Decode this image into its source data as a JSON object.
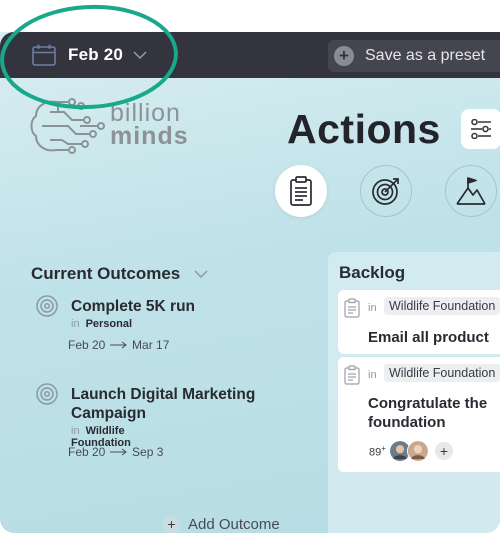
{
  "topbar": {
    "date": "Feb 20",
    "preset_label": "Save as a preset",
    "preset_icon": "+"
  },
  "logo": {
    "line1": "billion",
    "line2": "minds"
  },
  "page": {
    "title": "Actions"
  },
  "tabs": [
    {
      "icon": "clipboard-icon",
      "active": true
    },
    {
      "icon": "target-icon",
      "active": false
    },
    {
      "icon": "mountain-flag-icon",
      "active": false
    }
  ],
  "outcomes": {
    "header": "Current Outcomes",
    "items": [
      {
        "name": "Complete 5K run",
        "in_label": "in",
        "project": "Personal",
        "start": "Feb 20",
        "end": "Mar 17"
      },
      {
        "name": "Launch Digital Marketing Campaign",
        "in_label": "in",
        "project": "Wildlife Foundation",
        "start": "Feb 20",
        "end": "Sep 3"
      }
    ],
    "add_label": "Add Outcome",
    "add_icon": "+"
  },
  "backlog": {
    "header": "Backlog",
    "cards": [
      {
        "in_label": "in",
        "project": "Wildlife Foundation",
        "task": "Email all product"
      },
      {
        "in_label": "in",
        "project": "Wildlife Foundation",
        "task_line1": "Congratulate the",
        "task_line2": "foundation",
        "count": "89",
        "count_suffix": "+",
        "add_icon": "+"
      }
    ]
  },
  "colors": {
    "topbar": "#34343f",
    "highlight": "#1aa88c",
    "background": "#c9e7ec"
  }
}
